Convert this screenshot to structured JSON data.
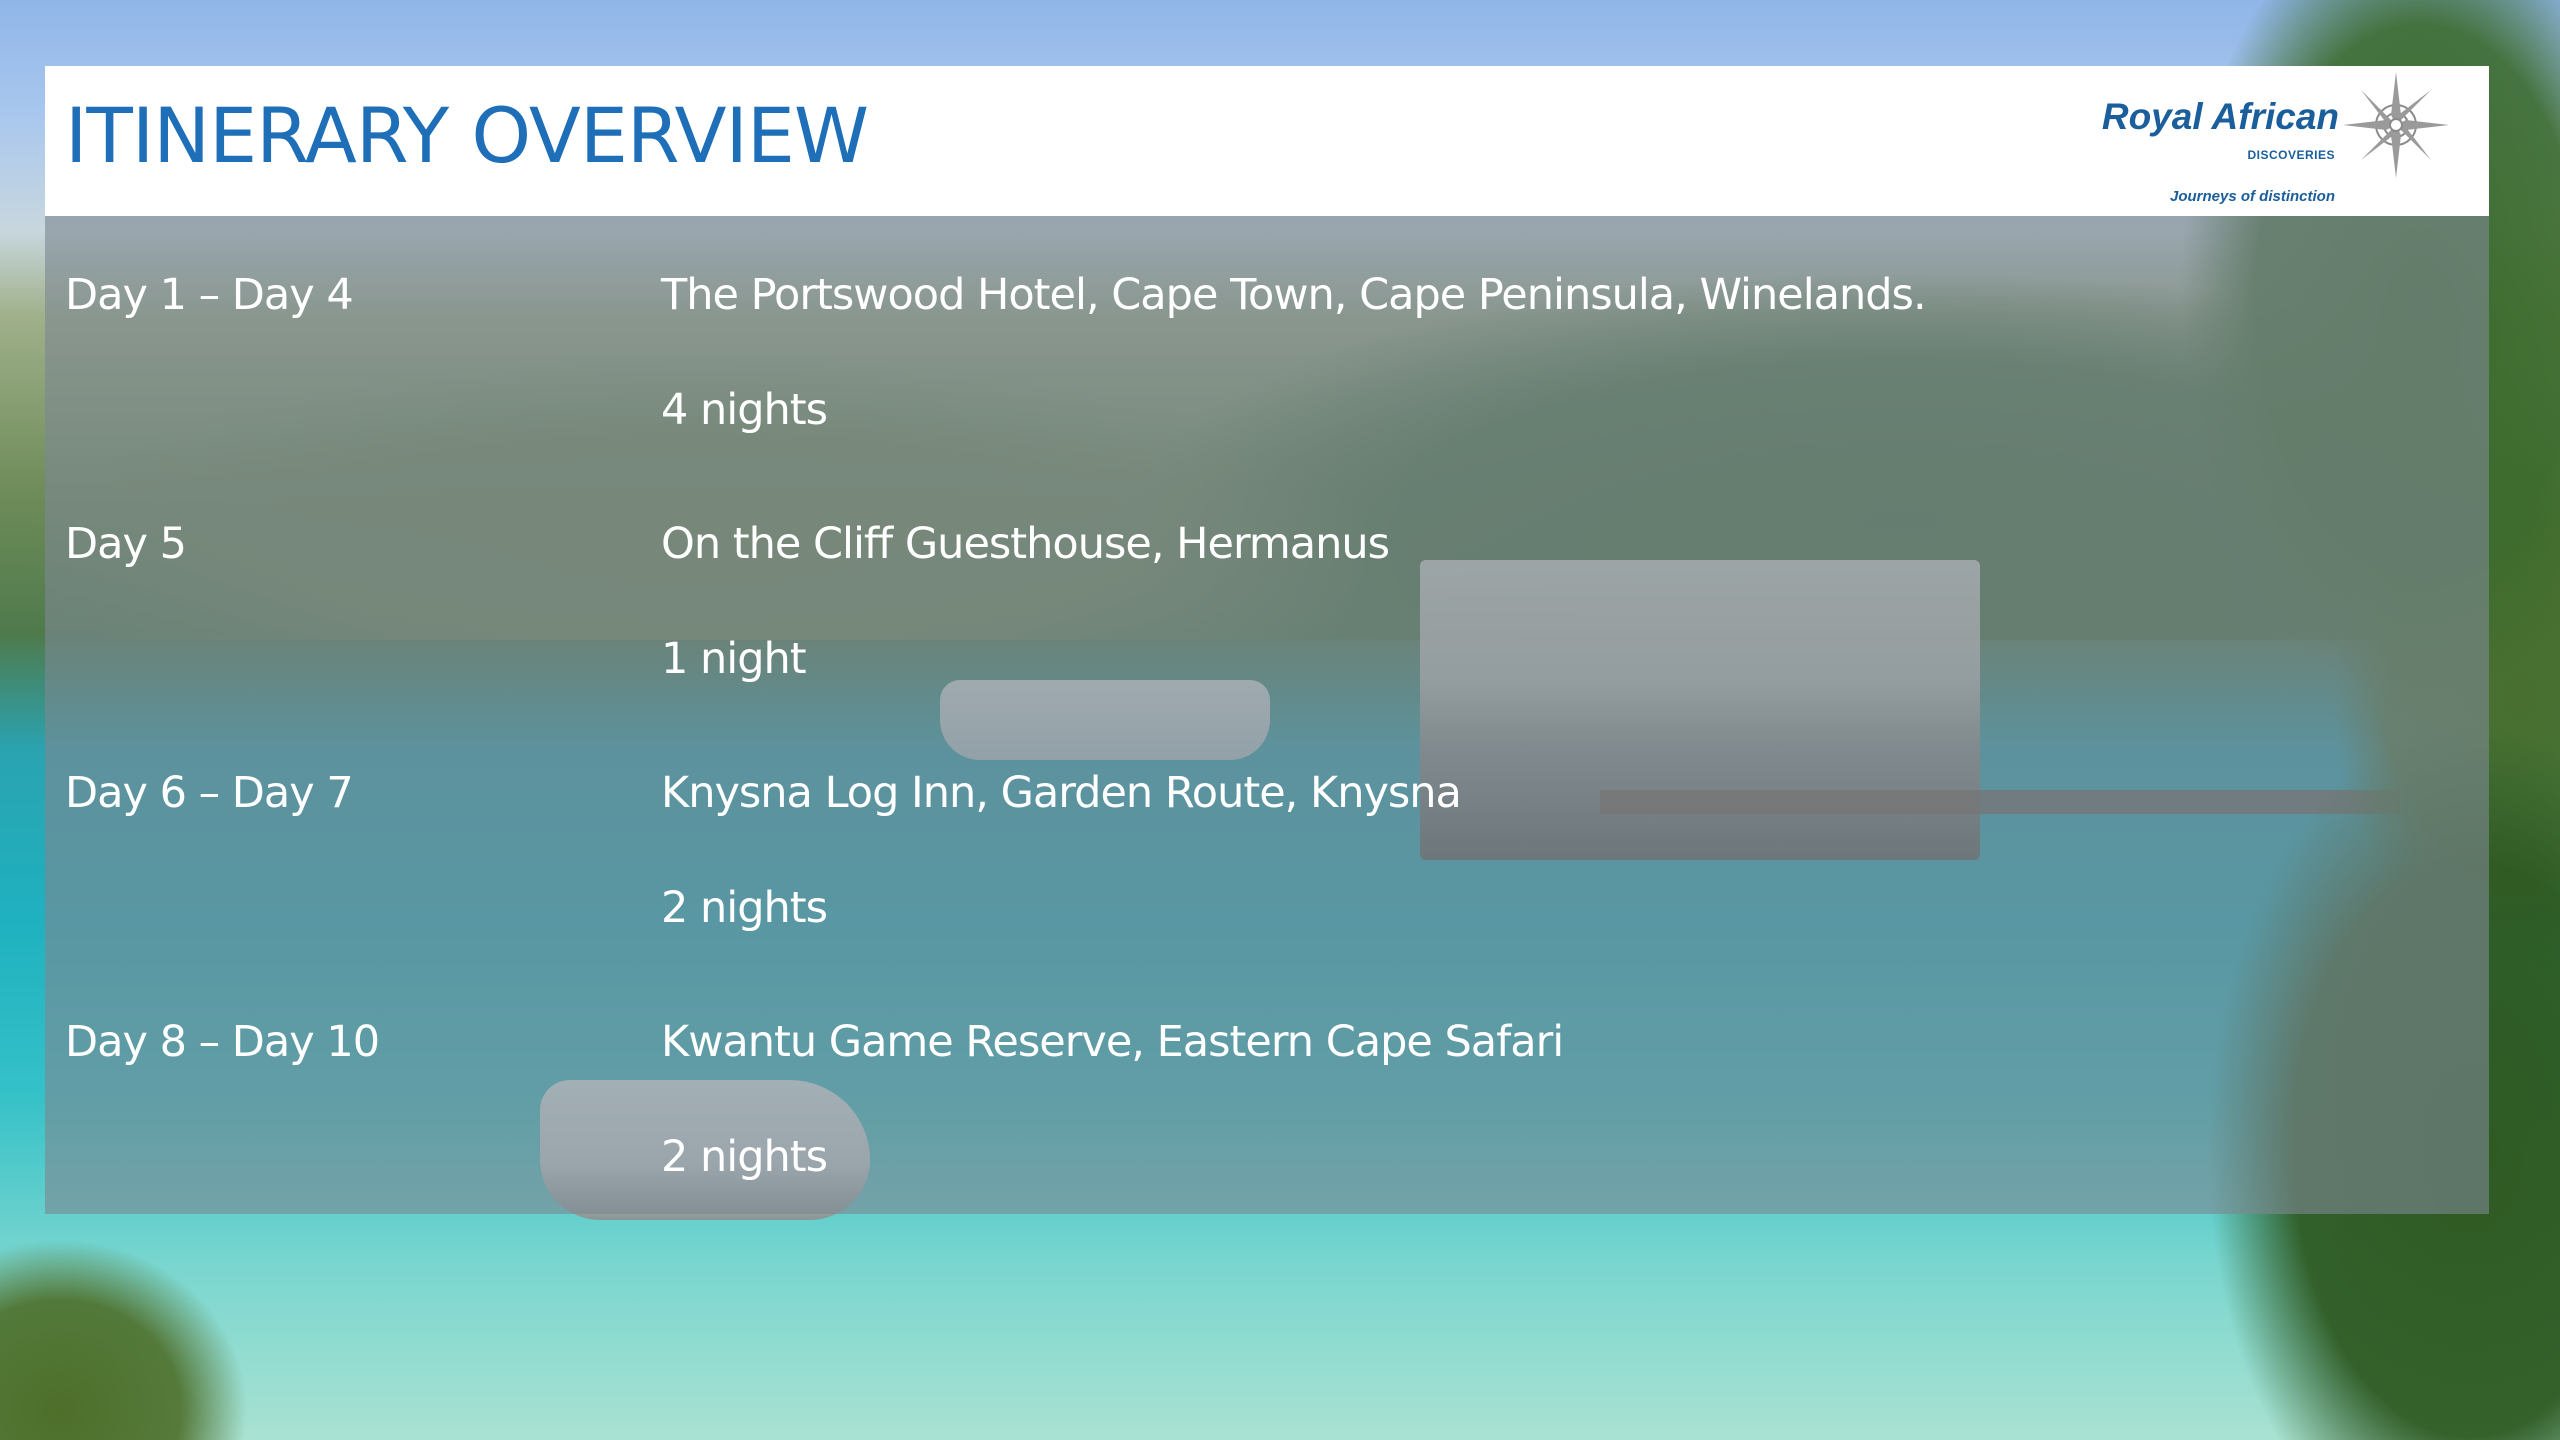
{
  "header": {
    "title": "ITINERARY OVERVIEW"
  },
  "logo": {
    "name": "Royal African",
    "sub": "DISCOVERIES",
    "tagline": "Journeys of distinction",
    "icon": "compass-rose-icon"
  },
  "itinerary": [
    {
      "days": "Day 1 – Day 4",
      "place": "The Portswood Hotel, Cape Town, Cape Peninsula, Winelands.",
      "nights": "4 nights"
    },
    {
      "days": "Day 5",
      "place": "On the Cliff Guesthouse, Hermanus",
      "nights": "1 night"
    },
    {
      "days": "Day 6 – Day 7",
      "place": "Knysna Log Inn, Garden Route, Knysna",
      "nights": "2 nights"
    },
    {
      "days": "Day 8 – Day 10",
      "place": "Kwantu Game Reserve, Eastern Cape Safari",
      "nights": "2 nights"
    }
  ],
  "colors": {
    "title": "#1f6fb8",
    "logo": "#1a5e9c",
    "panel_overlay": "#7d8791",
    "text": "#ffffff"
  }
}
